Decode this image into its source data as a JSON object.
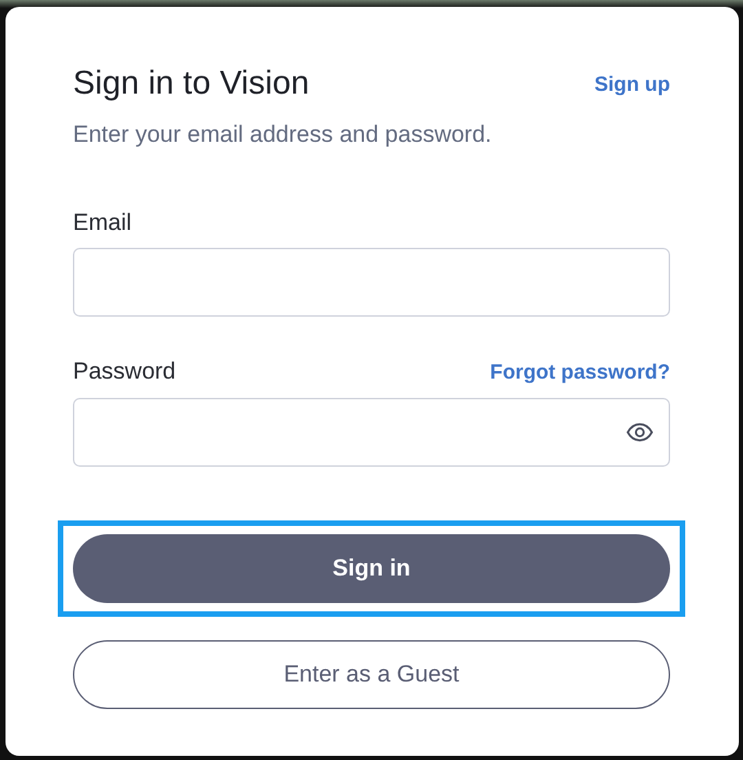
{
  "header": {
    "title": "Sign in to Vision",
    "signup_link": "Sign up",
    "subtitle": "Enter your email address and password."
  },
  "email": {
    "label": "Email"
  },
  "password": {
    "label": "Password",
    "forgot_link": "Forgot password?"
  },
  "buttons": [
    {
      "kind": "primary",
      "label": "Sign in",
      "focused": true
    },
    {
      "kind": "outline",
      "label": "Enter as a Guest",
      "focused": false
    }
  ]
}
